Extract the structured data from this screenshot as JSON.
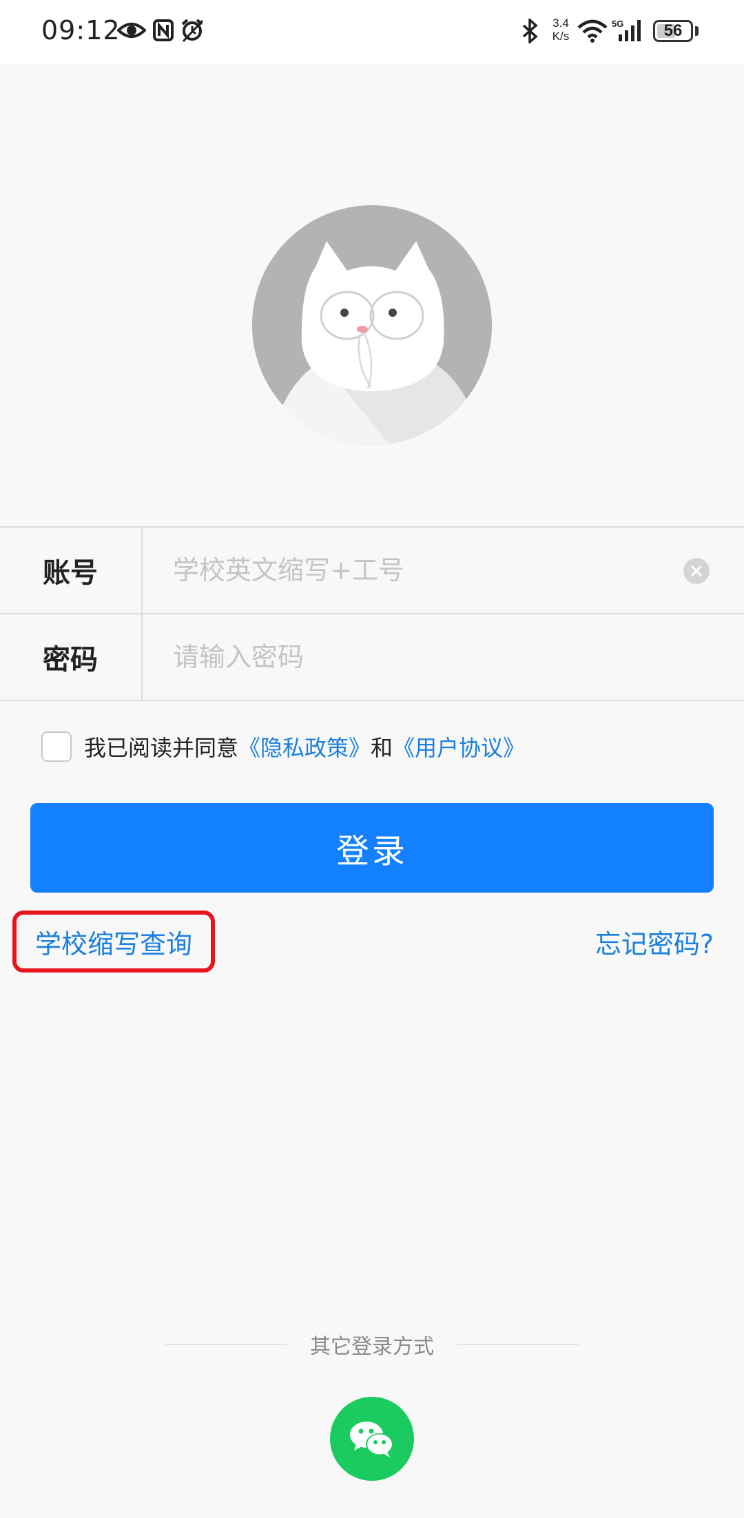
{
  "status_bar": {
    "time": "09:12",
    "net_speed_top": "3.4",
    "net_speed_bottom": "K/s",
    "battery": "56",
    "icons": [
      "eye-icon",
      "nfc-icon",
      "alarm-icon",
      "bluetooth-icon",
      "wifi-icon",
      "signal-5g-icon",
      "battery-icon"
    ]
  },
  "avatar": {
    "icon": "cat-avatar"
  },
  "form": {
    "account_label": "账号",
    "account_placeholder": "学校英文缩写+工号",
    "account_value": "",
    "password_label": "密码",
    "password_placeholder": "请输入密码",
    "password_value": ""
  },
  "agreement": {
    "checked": false,
    "prefix": "我已阅读并同意",
    "privacy_link": "《隐私政策》",
    "and": "和",
    "terms_link": "《用户协议》"
  },
  "login_button": "登录",
  "links": {
    "school_lookup": "学校缩写查询",
    "forgot_password": "忘记密码?"
  },
  "other_login": {
    "title": "其它登录方式",
    "wechat_icon": "wechat-icon"
  },
  "colors": {
    "primary": "#1380ff",
    "link": "#1a7fe0",
    "highlight": "#e8141c",
    "wechat": "#1ccb5f",
    "background": "#f8f8f8"
  }
}
